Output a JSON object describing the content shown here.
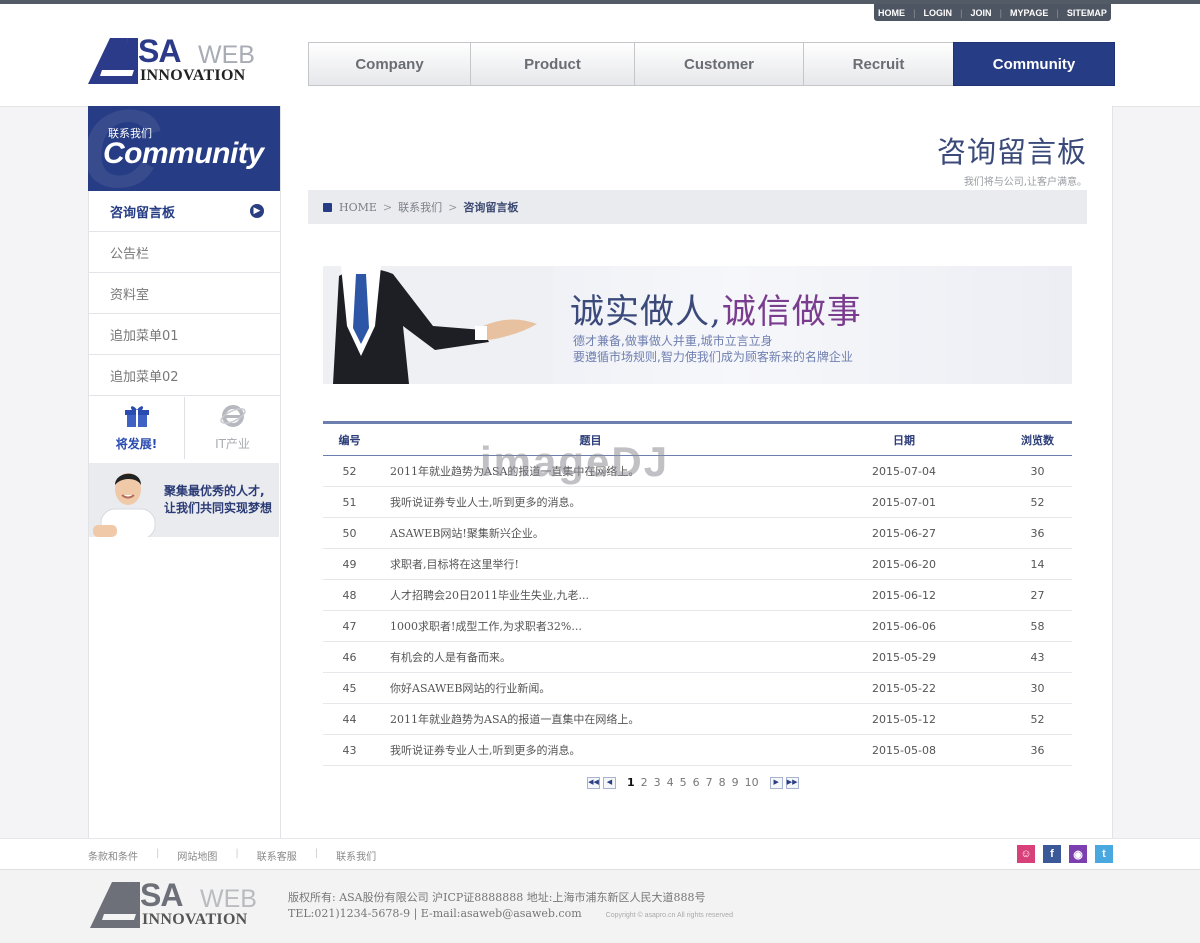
{
  "util_nav": [
    "HOME",
    "LOGIN",
    "JOIN",
    "MYPAGE",
    "SITEMAP"
  ],
  "logo": {
    "sa": "SA",
    "web": "WEB",
    "innovation": "INNOVATION"
  },
  "gnb": [
    "Company",
    "Product",
    "Customer",
    "Recruit",
    "Community"
  ],
  "sidebar": {
    "head_kor": "联系我们",
    "head_eng": "Community",
    "menu": [
      "咨询留言板",
      "公告栏",
      "资料室",
      "追加菜单01",
      "追加菜单02"
    ],
    "quick1": "将发展!",
    "quick2": "IT产业",
    "banner_line1": "聚集最优秀的人才,",
    "banner_line2": "让我们共同实现梦想"
  },
  "page": {
    "title": "咨询留言板",
    "subtitle": "我们将与公司,让客户满意。"
  },
  "breadcrumb": {
    "home": "HOME",
    "level1": "联系我们",
    "current": "咨询留言板"
  },
  "banner": {
    "headline_a": "诚实做人,",
    "headline_b": "诚信做事",
    "sub1": "德才兼备,做事做人并重,城市立言立身",
    "sub2": "要遵循市场规则,智力使我们成为顾客新来的名牌企业"
  },
  "table": {
    "headers": [
      "编号",
      "题目",
      "日期",
      "浏览数"
    ],
    "rows": [
      {
        "no": "52",
        "title": "2011年就业趋势为ASA的报道一直集中在网络上。",
        "date": "2015-07-04",
        "views": "30"
      },
      {
        "no": "51",
        "title": "我听说证券专业人士,听到更多的消息。",
        "date": "2015-07-01",
        "views": "52"
      },
      {
        "no": "50",
        "title": "ASAWEB网站!聚集新兴企业。",
        "date": "2015-06-27",
        "views": "36"
      },
      {
        "no": "49",
        "title": "求职者,目标将在这里举行!",
        "date": "2015-06-20",
        "views": "14"
      },
      {
        "no": "48",
        "title": "人才招聘会20日2011毕业生失业,九老...",
        "date": "2015-06-12",
        "views": "27"
      },
      {
        "no": "47",
        "title": "1000求职者!成型工作,为求职者32%...",
        "date": "2015-06-06",
        "views": "58"
      },
      {
        "no": "46",
        "title": "有机会的人是有备而来。",
        "date": "2015-05-29",
        "views": "43"
      },
      {
        "no": "45",
        "title": "你好ASAWEB网站的行业新闻。",
        "date": "2015-05-22",
        "views": "30"
      },
      {
        "no": "44",
        "title": "2011年就业趋势为ASA的报道一直集中在网络上。",
        "date": "2015-05-12",
        "views": "52"
      },
      {
        "no": "43",
        "title": "我听说证券专业人士,听到更多的消息。",
        "date": "2015-05-08",
        "views": "36"
      }
    ]
  },
  "pager": {
    "pages": [
      "1",
      "2",
      "3",
      "4",
      "5",
      "6",
      "7",
      "8",
      "9",
      "10"
    ],
    "current": "1"
  },
  "watermark": "imageDJ",
  "footer": {
    "links": [
      "条款和条件",
      "网站地图",
      "联系客服",
      "联系我们"
    ],
    "line1": "版权所有: ASA股份有限公司 沪ICP证8888888 地址:上海市浦东新区人民大道888号",
    "line2": "TEL:021)1234-5678-9 | E-mail:asaweb@asaweb.com",
    "copyright": "Copyright © asapro.cn All rights reserved"
  },
  "colors": {
    "brand": "#263c84",
    "social": [
      "#d8407a",
      "#3b5998",
      "#7b3fb0",
      "#49a8e0"
    ]
  }
}
